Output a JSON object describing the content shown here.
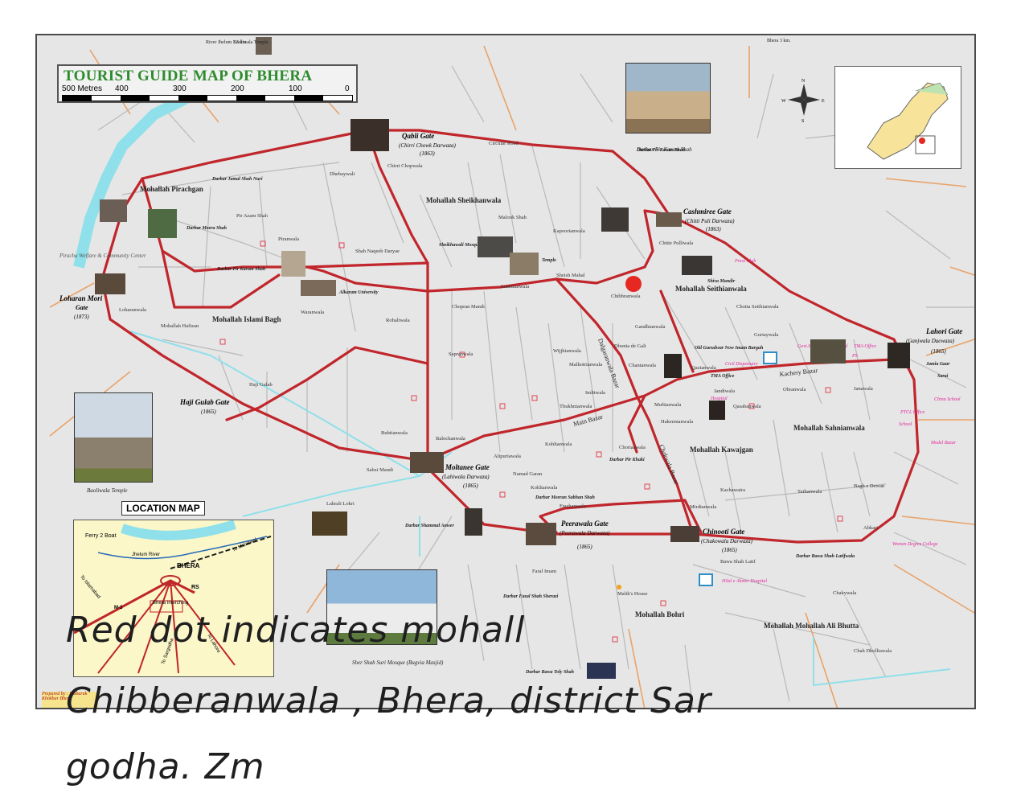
{
  "map": {
    "title": "TOURIST GUIDE MAP OF BHERA",
    "scale_labels": [
      "500 Metres",
      "400",
      "300",
      "200",
      "100",
      "0"
    ],
    "colors": {
      "road": "#c0262b",
      "street": "#b9b9b9",
      "water": "#8fe0ea",
      "minor_road": "#e8a36a",
      "gate_label": "#000000",
      "pink_label": "#e2249a",
      "marker": "#e52822"
    },
    "red_dot_label": "Chibberanwala",
    "gates": [
      {
        "name": "Qabli Gate",
        "sub": "(Chirri Chowk Darwaza)",
        "year": "(1863)"
      },
      {
        "name": "Cashmiree Gate",
        "sub": "(Chitti Puli Darwaza)",
        "year": "(1863)"
      },
      {
        "name": "Lahori Gate",
        "sub": "(Ganjwala Daewaza)",
        "year": "(1865)"
      },
      {
        "name": "Chinooti Gate",
        "sub": "(Chakowala Darwaza)",
        "year": "(1865)"
      },
      {
        "name": "Peerawala Gate",
        "sub": "(Peerawala Darwaza)",
        "year": "(1865)"
      },
      {
        "name": "Moltanee Gate",
        "sub": "(Lahiwala Darwaza)",
        "year": "(1865)"
      },
      {
        "name": "Haji Gulab Gate",
        "sub": "",
        "year": "(1865)"
      },
      {
        "name": "Loharan Mori",
        "sub": "Gate",
        "year": "(1873)"
      }
    ],
    "mohallas": [
      "Mohallah Pirachgan",
      "Mohallah Sheikhanwala",
      "Mohallah Seithianwala",
      "Mohallah Islami Bagh",
      "Mohallah Sahnianwala",
      "Mohallah Kawajgan",
      "Mohallah Bohri",
      "Mohallah Mohallah Ali Bhutta"
    ],
    "streets": [
      "Circular Road",
      "Dhebaywali",
      "Chirri Chopwala",
      "Malook Shah",
      "Kapoorianwala",
      "Chitte Pulliwala",
      "Piranwala",
      "Pir Azam Shah",
      "Shah Naqeeb Daryae",
      "Waranwala",
      "Rohaliwala",
      "Loharanwala",
      "Mohallah Hafizan",
      "Haji Gulab",
      "Sheish Mahal",
      "Anantianwala",
      "Chopran Mandi",
      "Chibbranwala",
      "Chotta Seithianwala",
      "Gandhianwala",
      "Dhonia de Gali",
      "Goriaywala",
      "Sapranwala",
      "Wijjhianwala",
      "Malhotrianwala",
      "Chantanwala",
      "Qazianwala",
      "Imlitwala",
      "Thukhnianwala",
      "Muftianwala",
      "Jandiwala",
      "Qasabanwala",
      "Obranwala",
      "Janawala",
      "Buhtianwala",
      "Balochanwala",
      "Kohlianwala",
      "Choriaawala",
      "Hakeemanwala",
      "Alipuriawala",
      "Namad Garan",
      "Kohlianwala",
      "Frashanwala",
      "Kachawaira",
      "Tailianwala",
      "Bagh e Dewan",
      "Abkari",
      "Mirdianwala",
      "Bawa Shah Latif",
      "Faral Imam",
      "Malik's House",
      "Chakywala",
      "Chah Dholliawala",
      "Sabzi Mandi",
      "Lahrali Lokri",
      "Main Bazar",
      "Dalgaranwala Bazar",
      "Chakwala Bazar",
      "Kachery Bazar"
    ],
    "landmarks": [
      "Darbar Jamal Shah Nuri",
      "Darbar Meera Shah",
      "Darbar Pir Karam Shah",
      "Alkaram University",
      "Piracha Welfare & Community Center",
      "Sheikhawali Mosque",
      "Temple",
      "Darbar Pir Karam Shah",
      "Shiva Mandir",
      "Press Club",
      "Old Gurudwar Now Imam Bargah",
      "Civil Dispensary",
      "Govt.Islamia High School",
      "TMA Office",
      "PS",
      "Darbar Jalal Shah",
      "Hospital",
      "Darbar Pir Khaki",
      "Darbar Meeran Sabhan Shah",
      "Darbar Shammal Anwer",
      "Darbar Fazal Shah Sherazi",
      "Darbar Bawa Toly Shah",
      "Darbar Bawa Shah Latifwala",
      "Hilal e Ahmer Hospital",
      "Sher Shah Suri Mosque (Bugvia Masjid)",
      "Baoliwala Temple",
      "Women Degree College",
      "PTCL Office",
      "School",
      "Model Bazar",
      "China School",
      "Jamia Gaar",
      "Sarai"
    ],
    "edge_notes": [
      "River Jhelum 1.5 km.",
      "Baoliwala Temple",
      "Bhera 3 km."
    ],
    "location_map": {
      "title": "LOCATION MAP",
      "labels": [
        "Ferry 2 Boat",
        "Jhelum River",
        "BHERA",
        "To Malakwal",
        "To Islamabad",
        "M-2",
        "Bhera Interching",
        "RS",
        "To Sargodha",
        "To Lahore",
        "To Bhera",
        "To Sargodha"
      ]
    },
    "footer": "Prepared by : Mubarak Khokhar Bhera"
  },
  "handwritten": {
    "line1": "Red dot indicates mohall",
    "line2": "Chibberanwala , Bhera, district Sar",
    "line3": "godha. Zm"
  }
}
